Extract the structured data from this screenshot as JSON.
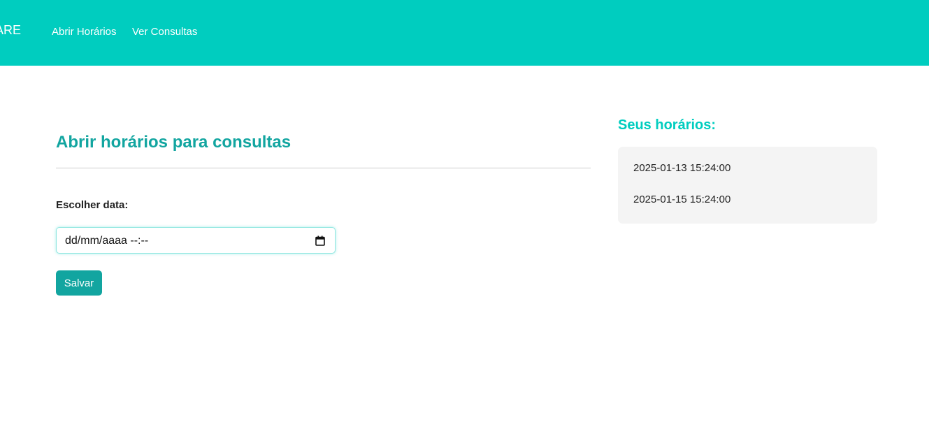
{
  "navbar": {
    "brand": "CARE",
    "links": [
      {
        "label": "Abrir Horários"
      },
      {
        "label": "Ver Consultas"
      }
    ],
    "background_color": "#00cdbf"
  },
  "main": {
    "title": "Abrir horários para consultas",
    "date_field": {
      "label": "Escolher data:",
      "placeholder": "dd/mm/aaaa --:--",
      "value": ""
    },
    "save_label": "Salvar",
    "accent_color": "#12a5a0"
  },
  "sidebar": {
    "title": "Seus horários:",
    "slots": [
      {
        "datetime": "2025-01-13 15:24:00"
      },
      {
        "datetime": "2025-01-15 15:24:00"
      }
    ]
  }
}
